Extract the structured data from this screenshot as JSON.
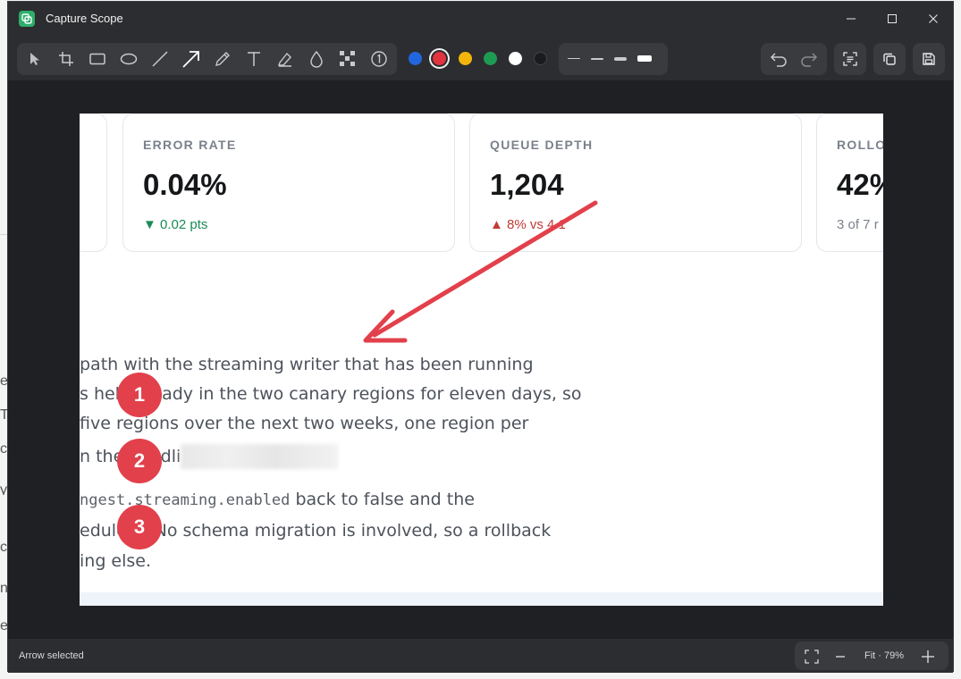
{
  "window": {
    "title": "Capture Scope"
  },
  "toolbar": {
    "tools": [
      {
        "icon": "select-pointer-icon"
      },
      {
        "icon": "crop-icon"
      },
      {
        "icon": "rectangle-icon"
      },
      {
        "icon": "ellipse-icon"
      },
      {
        "icon": "line-icon"
      },
      {
        "icon": "arrow-icon",
        "active": true
      },
      {
        "icon": "pen-icon"
      },
      {
        "icon": "text-icon"
      },
      {
        "icon": "highlighter-icon"
      },
      {
        "icon": "blur-drop-icon"
      },
      {
        "icon": "pixelate-icon"
      },
      {
        "icon": "step-number-icon"
      }
    ],
    "colors": [
      "#2266dd",
      "#e0343f",
      "#f2b50c",
      "#1e9b52",
      "#ffffff",
      "#1a1b1e"
    ],
    "selected_color": "#e0343f",
    "stroke_widths": [
      "thin",
      "medium",
      "thick",
      "extra-thick"
    ],
    "selected_stroke": "extra-thick"
  },
  "screenshot": {
    "cards": [
      {
        "label": "ERROR RATE",
        "value": "0.04%",
        "delta": "▼ 0.02 pts",
        "delta_color": "#1a8a55"
      },
      {
        "label": "QUEUE DEPTH",
        "value": "1,204",
        "delta": "▲ 8% vs 4.1",
        "delta_color": "#c23b35"
      },
      {
        "label": "ROLLO",
        "value": "42%",
        "delta": "3 of 7 r",
        "delta_color": "#7b818c"
      }
    ],
    "lines": {
      "l1": "path with the streaming writer that has been running",
      "l2": "s held steady in the two canary regions for eleven days, so",
      "l3": "five regions over the next two weeks, one region per",
      "l4": "n the headli",
      "l5_code": "ngest.streaming.enabled",
      "l5_rest": " back to false and the",
      "l6": "edule it. No schema migration is involved, so a rollback",
      "l7": "ing else."
    },
    "badges": [
      "1",
      "2",
      "3"
    ],
    "annotation_color": "#e2404b"
  },
  "status": {
    "text": "Arrow selected",
    "zoom": "Fit · 79%"
  }
}
